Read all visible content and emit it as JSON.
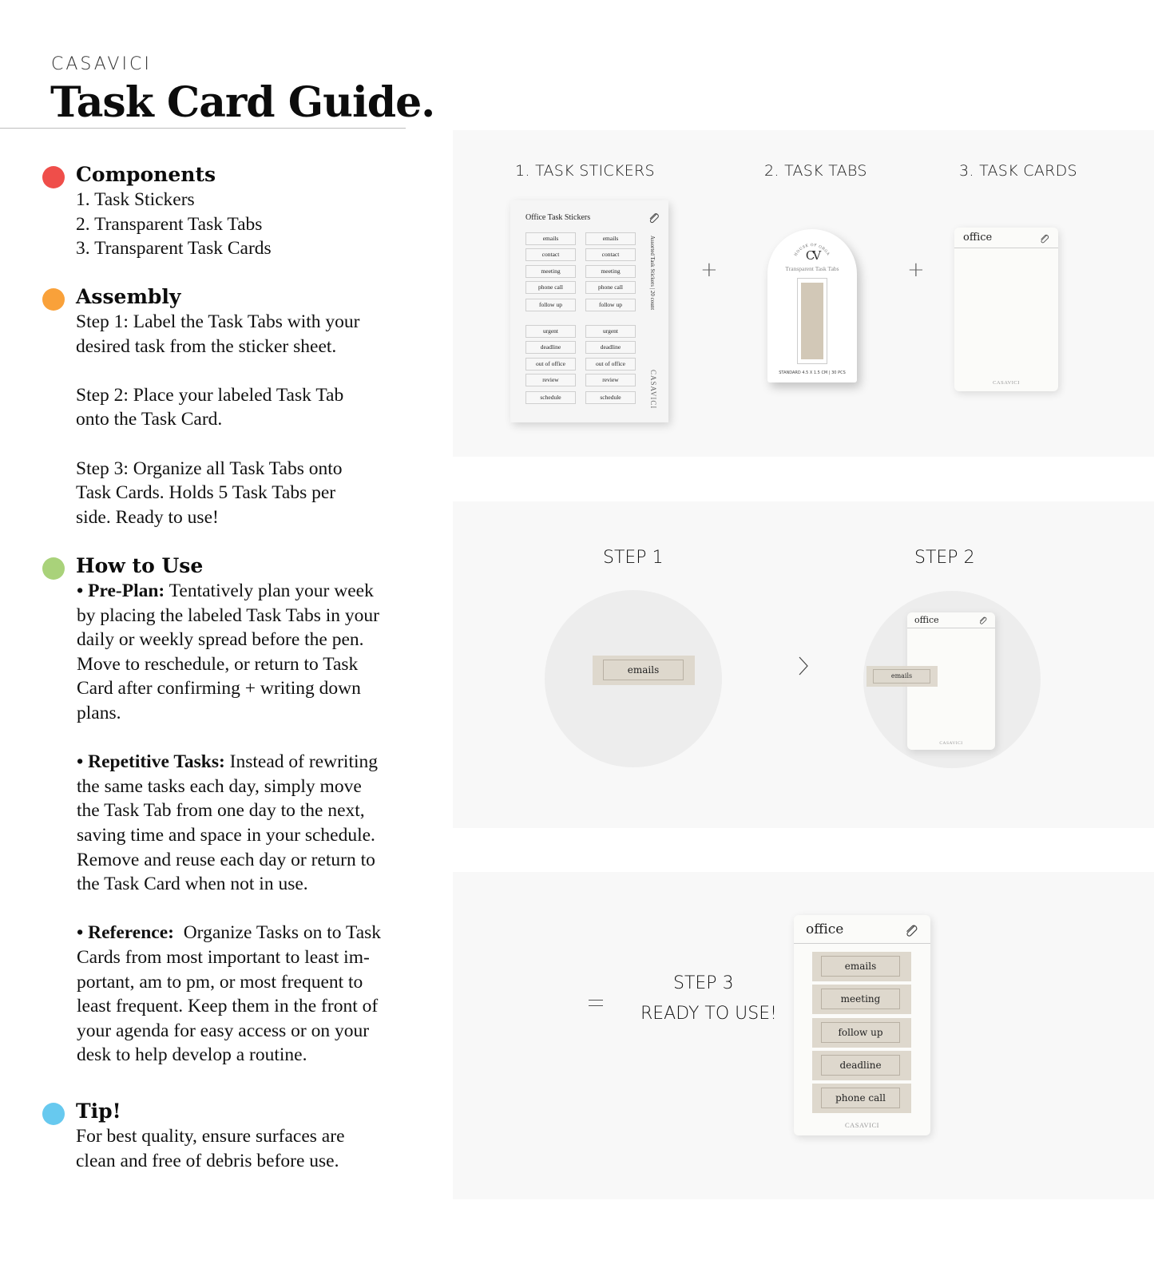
{
  "header": {
    "brand": "CASAVICI",
    "title": "Task Card Guide."
  },
  "colors": {
    "components_dot": "#ef4e4a",
    "assembly_dot": "#f9a13a",
    "how_to_use_dot": "#a9d27a",
    "tip_dot": "#67c9ef",
    "tab_fill": "#ded8cd",
    "panel_bg": "#f8f8f8"
  },
  "components": {
    "title": "Components",
    "items": [
      "1. Task Stickers",
      "2. Transparent Task Tabs",
      "3. Transparent Task Cards"
    ]
  },
  "assembly": {
    "title": "Assembly",
    "steps": [
      [
        "Step 1: Label the Task Tabs with your",
        "desired task from the sticker sheet."
      ],
      [
        "Step 2: Place your labeled Task Tab",
        "onto the Task Card."
      ],
      [
        "Step 3: Organize all Task Tabs onto",
        "Task Cards. Holds 5 Task Tabs per",
        "side. Ready to use!"
      ]
    ]
  },
  "how_to_use": {
    "title": "How to Use",
    "items": [
      {
        "label": "• Pre-Plan:",
        "first": " Tentatively plan your week",
        "lines": [
          "by placing the labeled Task Tabs in your",
          "daily or weekly spread before the pen.",
          "Move to reschedule, or return to Task",
          "Card after confirming + writing down",
          "plans."
        ]
      },
      {
        "label": "• Repetitive Tasks:",
        "first": " Instead of rewriting",
        "lines": [
          "the same tasks each day, simply move",
          "the Task Tab from one day to the next,",
          "saving time and space in your schedule.",
          "Remove and reuse each day or return to",
          "the Task Card when not in use."
        ]
      },
      {
        "label": "• Reference:",
        "first": "  Organize Tasks on to Task",
        "lines": [
          "Cards from most important to least im-",
          "portant, am to pm, or most frequent to",
          "least frequent. Keep them in the front of",
          "your agenda for easy access or on your",
          "desk to help develop a routine."
        ]
      }
    ]
  },
  "tip": {
    "title": "Tip!",
    "lines": [
      "For best quality, ensure surfaces are",
      "clean and free of debris before use."
    ]
  },
  "panel_components": {
    "labels": [
      "1. TASK STICKERS",
      "2. TASK TABS",
      "3. TASK CARDS"
    ],
    "plus_symbol": "+",
    "sticker_sheet": {
      "title": "Office Task Stickers",
      "side_text": "Assorted Task Stickers | 20 count",
      "brand": "CASAVICI",
      "stickers": [
        "emails",
        "contact",
        "meeting",
        "phone call",
        "follow up",
        "urgent",
        "deadline",
        "out of office",
        "review",
        "schedule"
      ]
    },
    "tab_pack": {
      "arc_text": "HOUSE OF ORGANIZATION",
      "logo": "CV",
      "name": "Transparent Task Tabs",
      "spec": "STANDARD 4.5 X 1.5 CM | 30 PCS"
    },
    "card": {
      "title": "office",
      "brand": "CASAVICI"
    }
  },
  "panel_steps": {
    "step1_label": "STEP 1",
    "step2_label": "STEP 2",
    "step1_tab": "emails",
    "step2_card_title": "office",
    "step2_tab": "emails",
    "step2_card_brand": "CASAVICI"
  },
  "panel_result": {
    "step3_label": "STEP 3",
    "ready_label": "READY TO USE!",
    "card_title": "office",
    "card_brand": "CASAVICI",
    "tabs": [
      "emails",
      "meeting",
      "follow up",
      "deadline",
      "phone call"
    ]
  }
}
